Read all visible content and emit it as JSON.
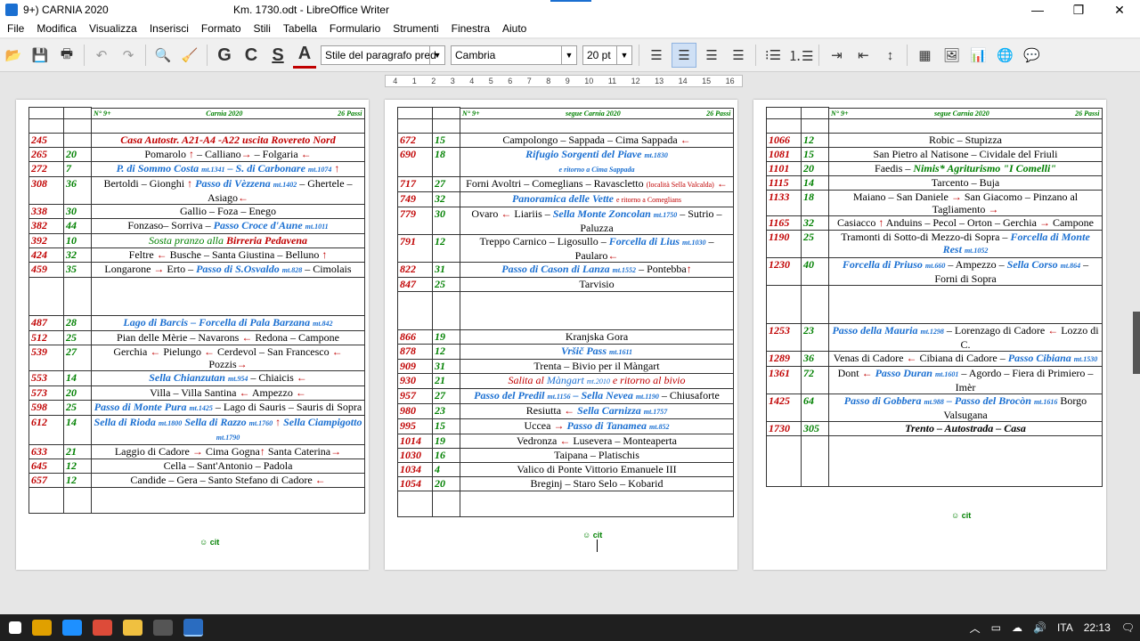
{
  "window": {
    "title_prefix": "9+) CARNIA 2020",
    "title": "Km. 1730.odt - LibreOffice Writer",
    "minimize": "—",
    "maximize": "❐",
    "close": "✕"
  },
  "menu": [
    "File",
    "Modifica",
    "Visualizza",
    "Inserisci",
    "Formato",
    "Stili",
    "Tabella",
    "Formulario",
    "Strumenti",
    "Finestra",
    "Aiuto"
  ],
  "toolbar": {
    "paragraph_style": "Stile del paragrafo pred",
    "font_name": "Cambria",
    "font_size": "20 pt",
    "bold": "G",
    "italic": "C",
    "underline": "S",
    "font_color": "A"
  },
  "ruler": [
    "4",
    "1",
    "2",
    "3",
    "4",
    "5",
    "6",
    "7",
    "8",
    "9",
    "10",
    "11",
    "12",
    "13",
    "14",
    "15",
    "16"
  ],
  "pages": [
    {
      "header": [
        "N° 9+",
        "Carnia 2020",
        "26 Passi"
      ],
      "rows": [
        {
          "a": "",
          "b": "",
          "html": ""
        },
        {
          "a": "245",
          "b": "",
          "html": "<span class='red bold'>Casa Autostr. A21-A4 -A22 uscita Rovereto Nord</span>"
        },
        {
          "a": "265",
          "b": "20",
          "html": "Pomarolo <span class='red'>↑</span> – Calliano<span class='red'>→</span> – Folgaria <span class='red'>←</span>"
        },
        {
          "a": "272",
          "b": "7",
          "html": "<span class='blue'>P. di Sommo Costa <small>mt.1341</small> – S. di Carbonare <small>mt.1074</small></span> <span class='red'>↑</span>"
        },
        {
          "a": "308",
          "b": "36",
          "html": "Bertoldi – Gionghi <span class='red'>↑</span> <span class='blue'>Passo di Vèzzena <small>mt.1402</small></span> – Ghertele – Asiago<span class='red'>←</span>"
        },
        {
          "a": "338",
          "b": "30",
          "html": "Gallio – Foza – Enego"
        },
        {
          "a": "382",
          "b": "44",
          "html": "Fonzaso– Sorriva – <span class='blue'>Passo Croce d'Aune <small>mt.1011</small></span>"
        },
        {
          "a": "392",
          "b": "10",
          "html": "<span class='green'>Sosta pranzo alla</span> <span class='red bold'>Birreria Pedavena</span>"
        },
        {
          "a": "424",
          "b": "32",
          "html": "Feltre <span class='red'>←</span> Busche – Santa Giustina – Belluno <span class='red'>↑</span>"
        },
        {
          "a": "459",
          "b": "35",
          "html": "Longarone <span class='red'>→</span> Erto – <span class='blue'>Passo di S.Osvaldo <small>mt.828</small></span> – Cimolais"
        },
        {
          "a": "",
          "b": "",
          "html": "&nbsp;<br>&nbsp;<br>&nbsp;"
        },
        {
          "a": "487",
          "b": "28",
          "html": "<span class='blue'>Lago di Barcis – Forcella di Pala Barzana <small>mt.842</small></span>"
        },
        {
          "a": "512",
          "b": "25",
          "html": "Pian delle Mèrie – Navarons <span class='red'>←</span> Redona – Campone"
        },
        {
          "a": "539",
          "b": "27",
          "html": "Gerchia <span class='red'>←</span> Pielungo <span class='red'>←</span> Cerdevol – San Francesco <span class='red'>←</span> Pozzis<span class='red'>→</span>"
        },
        {
          "a": "553",
          "b": "14",
          "html": "<span class='blue'>Sella Chianzutan <small>mt.954</small></span> – Chiaicis <span class='red'>←</span>"
        },
        {
          "a": "573",
          "b": "20",
          "html": "Villa – Villa Santina <span class='red'>←</span> Ampezzo <span class='red'>←</span>"
        },
        {
          "a": "598",
          "b": "25",
          "html": "<span class='blue'>Passo di Monte Pura <small>mt.1425</small></span> – Lago di Sauris – Sauris di Sopra"
        },
        {
          "a": "612",
          "b": "14",
          "html": "<span class='blue'>Sella di Rioda <small>mt.1800</small> Sella di Razzo <small>mt.1760</small></span> <span class='red'>↑</span> <span class='blue'>Sella Ciampigotto <small>mt.1790</small></span>"
        },
        {
          "a": "633",
          "b": "21",
          "html": "Laggio di Cadore <span class='red'>→</span> Cima Gogna<span class='red'>↑</span> Santa Caterina<span class='red'>→</span>"
        },
        {
          "a": "645",
          "b": "12",
          "html": "Cella – Sant'Antonio – Padola"
        },
        {
          "a": "657",
          "b": "12",
          "html": "Candide – Gera – Santo Stefano di Cadore <span class='red'>←</span>"
        },
        {
          "a": "",
          "b": "",
          "html": "&nbsp;<br>&nbsp;"
        }
      ],
      "footer": "☺ cit"
    },
    {
      "header": [
        "N° 9+",
        "segue Carnia 2020",
        "26 Passi"
      ],
      "rows": [
        {
          "a": "",
          "b": "",
          "html": ""
        },
        {
          "a": "672",
          "b": "15",
          "html": "Campolongo – Sappada – Cima Sappada <span class='red'>←</span>"
        },
        {
          "a": "690",
          "b": "18",
          "html": "<span class='blue'>Rifugio Sorgenti del Piave <small>mt.1830</small></span><br><span class='blue'><small>e ritorno a Cima Sappada</small></span>"
        },
        {
          "a": "717",
          "b": "27",
          "html": "Forni Avoltri – Comeglians – Ravascletto <span class='red'><small>(località Sella Valcalda)</small></span> <span class='red'>←</span>"
        },
        {
          "a": "749",
          "b": "32",
          "html": "<span class='blue'>Panoramica delle Vette</span> <span class='red'><small>e ritorno a Comeglians</small></span>"
        },
        {
          "a": "779",
          "b": "30",
          "html": "Ovaro <span class='red'>←</span> Liariis – <span class='blue'>Sella Monte Zoncolan <small>mt.1750</small></span> – Sutrio – Paluzza"
        },
        {
          "a": "791",
          "b": "12",
          "html": "Treppo Carnico – Ligosullo – <span class='blue'>Forcella di Lius <small>mt.1030</small></span> – Paularo<span class='red'>←</span>"
        },
        {
          "a": "822",
          "b": "31",
          "html": "<span class='blue'>Passo di Cason di Lanza <small>mt.1552</small></span> – Pontebba<span class='red'>↑</span>"
        },
        {
          "a": "847",
          "b": "25",
          "html": "Tarvisio"
        },
        {
          "a": "",
          "b": "",
          "html": "&nbsp;<br>&nbsp;<br>&nbsp;"
        },
        {
          "a": "866",
          "b": "19",
          "html": "Kranjska Gora"
        },
        {
          "a": "878",
          "b": "12",
          "html": "<span class='blue'>Vršič Pass <small>mt.1611</small></span>"
        },
        {
          "a": "909",
          "b": "31",
          "html": "Trenta – Bivio per il Màngart"
        },
        {
          "a": "930",
          "b": "21",
          "html": "<span class='red' style='font-style:italic'>Salita al</span> <span class='blue' style='font-weight:normal'>Màngart <small>mt.2010</small></span> <span class='red' style='font-style:italic'>e ritorno al bivio</span>"
        },
        {
          "a": "957",
          "b": "27",
          "html": "<span class='blue'>Passo del Predil <small>mt.1156</small> – Sella Nevea <small>mt.1190</small></span> – Chiusaforte"
        },
        {
          "a": "980",
          "b": "23",
          "html": "Resiutta <span class='red'>←</span> <span class='blue'>Sella Carnizza <small>mt.1757</small></span>"
        },
        {
          "a": "995",
          "b": "15",
          "html": "Uccea <span class='red'>→</span> <span class='blue'>Passo di Tanamea <small>mt.852</small></span>"
        },
        {
          "a": "1014",
          "b": "19",
          "html": "Vedronza <span class='red'>←</span> Lusevera – Monteaperta"
        },
        {
          "a": "1030",
          "b": "16",
          "html": "Taipana – Platischis"
        },
        {
          "a": "1034",
          "b": "4",
          "html": "Valico di Ponte Vittorio Emanuele III"
        },
        {
          "a": "1054",
          "b": "20",
          "html": "Breginj – Staro Selo – Kobarid"
        },
        {
          "a": "",
          "b": "",
          "html": "&nbsp;<br>&nbsp;"
        }
      ],
      "footer": "☺ cit"
    },
    {
      "header": [
        "N° 9+",
        "segue Carnia 2020",
        "26 Passi"
      ],
      "rows": [
        {
          "a": "",
          "b": "",
          "html": ""
        },
        {
          "a": "1066",
          "b": "12",
          "html": "Robic – Stupizza"
        },
        {
          "a": "1081",
          "b": "15",
          "html": "San Pietro al Natisone – Cividale del Friuli"
        },
        {
          "a": "1101",
          "b": "20",
          "html": "Faedis – <span class='green' style='font-weight:bold'>Nimis* Agriturismo \"I Comelli\"</span>"
        },
        {
          "a": "1115",
          "b": "14",
          "html": "Tarcento – Buja"
        },
        {
          "a": "1133",
          "b": "18",
          "html": "Maiano – San Daniele <span class='red'>→</span> San Giacomo – Pinzano al Tagliamento <span class='red'>→</span>"
        },
        {
          "a": "1165",
          "b": "32",
          "html": "Casiacco <span class='red'>↑</span> Anduins – Pecol – Orton – Gerchia <span class='red'>→</span> Campone"
        },
        {
          "a": "1190",
          "b": "25",
          "html": "Tramonti di Sotto-di Mezzo-di Sopra – <span class='blue'>Forcella di Monte Rest <small>mt.1052</small></span>"
        },
        {
          "a": "1230",
          "b": "40",
          "html": "<span class='blue'>Forcella di Priuso <small>mt.660</small></span> – Ampezzo – <span class='blue'>Sella Corso <small>mt.864</small></span> – Forni di Sopra"
        },
        {
          "a": "",
          "b": "",
          "html": "&nbsp;<br>&nbsp;<br>&nbsp;"
        },
        {
          "a": "1253",
          "b": "23",
          "html": "<span class='blue'>Passo della Mauria <small>mt.1298</small></span> – Lorenzago di Cadore <span class='red'>←</span> Lozzo di C."
        },
        {
          "a": "1289",
          "b": "36",
          "html": "Venas di Cadore <span class='red'>←</span> Cibiana di Cadore – <span class='blue'>Passo Cibiana <small>mt.1530</small></span>"
        },
        {
          "a": "1361",
          "b": "72",
          "html": "Dont <span class='red'>←</span> <span class='blue'>Passo Duran <small>mt.1601</small></span> – Agordo – Fiera di Primiero – Imèr"
        },
        {
          "a": "1425",
          "b": "64",
          "html": "<span class='blue'>Passo di Gobbera <small>mt.988</small> – Passo del Brocòn <small>mt.1616</small></span> Borgo Valsugana"
        },
        {
          "a": "1730",
          "b": "305",
          "html": "<span class='bold'>Trento – Autostrada – Casa</span>"
        },
        {
          "a": "",
          "b": "",
          "html": "&nbsp;<br>&nbsp;<br>&nbsp;<br>&nbsp;"
        }
      ],
      "footer": "☺ cit"
    }
  ],
  "taskbar": {
    "language": "ITA",
    "time": "22:13"
  }
}
